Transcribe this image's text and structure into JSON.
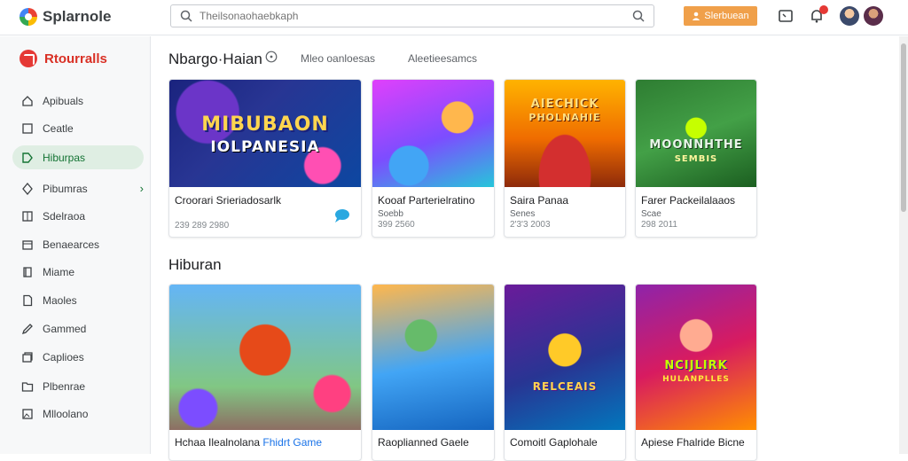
{
  "app": {
    "name": "Splarnole"
  },
  "search": {
    "placeholder": "Theilsonaohaebkaph"
  },
  "header": {
    "cta_label": "Slerbuean"
  },
  "sidebar": {
    "heading": "Rtourralls",
    "items": [
      {
        "label": "Apibuals",
        "icon": "home-icon"
      },
      {
        "label": "Ceatle",
        "icon": "square-icon"
      },
      {
        "label": "Hiburpas",
        "icon": "tag-icon",
        "active": true
      },
      {
        "label": "Pibumras",
        "icon": "diamond-icon",
        "chevron": "›"
      },
      {
        "label": "Sdelraoa",
        "icon": "grid-icon"
      },
      {
        "label": "Benaearces",
        "icon": "box-icon"
      },
      {
        "label": "Miame",
        "icon": "book-icon"
      },
      {
        "label": "Maoles",
        "icon": "doc-icon"
      },
      {
        "label": "Gammed",
        "icon": "pencil-icon"
      },
      {
        "label": "Caplioes",
        "icon": "stack-icon"
      },
      {
        "label": "Plbenrae",
        "icon": "folder-icon"
      },
      {
        "label": "Mlloolano",
        "icon": "image-icon"
      }
    ]
  },
  "main": {
    "section1": {
      "title": "Nbargo·Haian",
      "filters": [
        "Mleo oanloesas",
        "Aleetieesamcs"
      ],
      "cards": [
        {
          "name": "Croorari Srieriadosarlk",
          "sub": "",
          "meta": "239 289 2980",
          "thumb_title": "MIBUBAON",
          "thumb_sub": "IOLPANESIA",
          "has_chat": true
        },
        {
          "name": "Kooaf Parterielratino",
          "sub": "Soebb",
          "meta": "399 2560",
          "thumb_title": "",
          "thumb_sub": ""
        },
        {
          "name": "Saira Panaa",
          "sub": "Senes",
          "meta": "2'3'3 2003",
          "thumb_title": "AIECHICK",
          "thumb_sub": "PHOLNAHIE"
        },
        {
          "name": "Farer Packeilalaaos",
          "sub": "Scae",
          "meta": "298 2011",
          "thumb_title": "MOONNHTHE",
          "thumb_sub": "SEMBIS"
        }
      ]
    },
    "section2": {
      "title": "Hiburan",
      "cards": [
        {
          "name_pre": "Hchaa Ilealnolana ",
          "name_hl": "Fhidrt Game",
          "thumb_title": ""
        },
        {
          "name": "Raoplianned Gaele",
          "thumb_title": ""
        },
        {
          "name": "Comoitl Gaplohale",
          "thumb_title": "RELCEAIS"
        },
        {
          "name": "Apiese Fhalride Bicne",
          "thumb_title": "NCIJLIRK",
          "thumb_sub": "HULANPLLES"
        }
      ]
    }
  },
  "colors": {
    "accent": "#f0a04a",
    "active_green": "#137333",
    "brand_red": "#d93025",
    "link": "#1a73e8"
  }
}
